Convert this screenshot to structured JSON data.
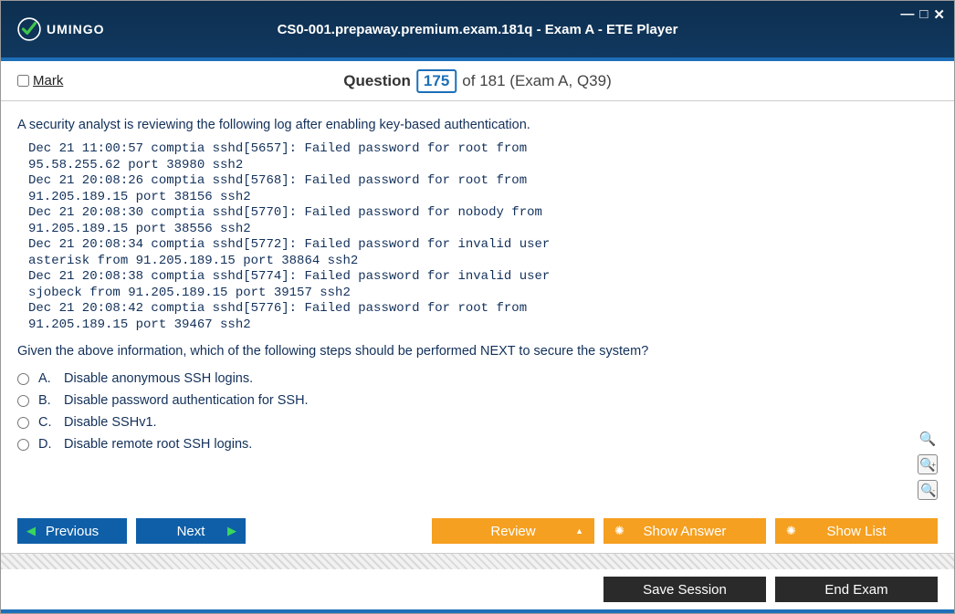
{
  "window": {
    "title": "CS0-001.prepaway.premium.exam.181q - Exam A - ETE Player",
    "brand": "UMINGO"
  },
  "header": {
    "mark_label": "Mark",
    "question_word": "Question",
    "question_number": "175",
    "of_text": "of 181 (Exam A, Q39)"
  },
  "question": {
    "intro": "A security analyst is reviewing the following log after enabling key-based authentication.",
    "log": "Dec 21 11:00:57 comptia sshd[5657]: Failed password for root from\n95.58.255.62 port 38980 ssh2\nDec 21 20:08:26 comptia sshd[5768]: Failed password for root from\n91.205.189.15 port 38156 ssh2\nDec 21 20:08:30 comptia sshd[5770]: Failed password for nobody from\n91.205.189.15 port 38556 ssh2\nDec 21 20:08:34 comptia sshd[5772]: Failed password for invalid user\nasterisk from 91.205.189.15 port 38864 ssh2\nDec 21 20:08:38 comptia sshd[5774]: Failed password for invalid user\nsjobeck from 91.205.189.15 port 39157 ssh2\nDec 21 20:08:42 comptia sshd[5776]: Failed password for root from\n91.205.189.15 port 39467 ssh2",
    "prompt": "Given the above information, which of the following steps should be performed NEXT to secure the system?",
    "answers": [
      {
        "letter": "A.",
        "text": "Disable anonymous SSH logins."
      },
      {
        "letter": "B.",
        "text": "Disable password authentication for SSH."
      },
      {
        "letter": "C.",
        "text": "Disable SSHv1."
      },
      {
        "letter": "D.",
        "text": "Disable remote root SSH logins."
      }
    ]
  },
  "footer": {
    "previous": "Previous",
    "next": "Next",
    "review": "Review",
    "show_answer": "Show Answer",
    "show_list": "Show List",
    "save_session": "Save Session",
    "end_exam": "End Exam"
  }
}
